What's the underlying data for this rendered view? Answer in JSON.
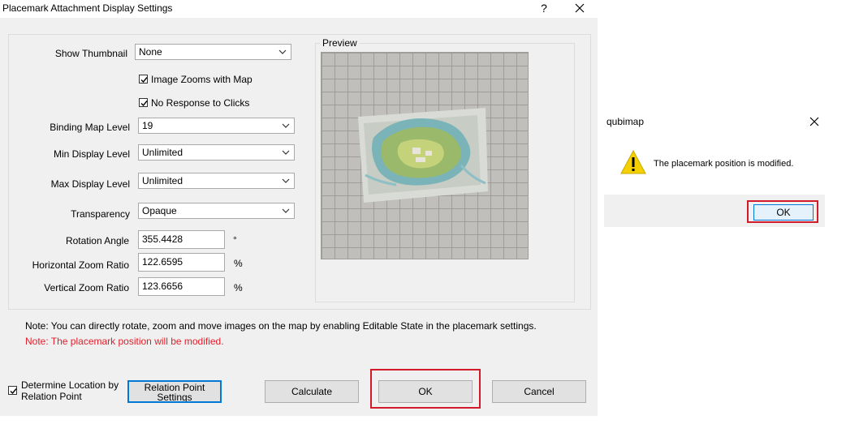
{
  "dialog": {
    "title": "Placemark Attachment Display Settings",
    "help_icon": "question-mark-icon",
    "close_icon": "close-icon",
    "show_thumbnail": {
      "label": "Show Thumbnail",
      "value": "None"
    },
    "image_zooms": {
      "label": "Image Zooms with Map",
      "checked": true
    },
    "no_response": {
      "label": "No Response to Clicks",
      "checked": true
    },
    "binding_level": {
      "label": "Binding Map Level",
      "value": "19"
    },
    "min_level": {
      "label": "Min Display Level",
      "value": "Unlimited"
    },
    "max_level": {
      "label": "Max Display Level",
      "value": "Unlimited"
    },
    "transparency": {
      "label": "Transparency",
      "value": "Opaque"
    },
    "rotation": {
      "label": "Rotation Angle",
      "value": "355.4428",
      "unit": "°"
    },
    "h_zoom": {
      "label": "Horizontal Zoom Ratio",
      "value": "122.6595",
      "unit": "%"
    },
    "v_zoom": {
      "label": "Vertical Zoom Ratio",
      "value": "123.6656",
      "unit": "%"
    },
    "preview_label": "Preview",
    "note": "Note: You can directly rotate, zoom and move images on the map by enabling Editable State in the placemark settings.",
    "warning": "Note: The placemark position will be modified.",
    "determine_location": {
      "line1": "Determine Location by",
      "line2": "Relation Point",
      "checked": true
    },
    "relation_btn": {
      "line1": "Relation Point",
      "line2": "Settings"
    },
    "calculate_btn": "Calculate",
    "ok_btn": "OK",
    "cancel_btn": "Cancel"
  },
  "message_box": {
    "title": "qubimap",
    "close_icon": "close-icon",
    "icon": "warning-triangle-icon",
    "message": "The placemark position is modified.",
    "ok_btn": "OK"
  },
  "colors": {
    "highlight_red": "#d11a2a",
    "dialog_bg": "#f0f0f0",
    "warning_text": "#e0202c",
    "warning_icon": "#f5d000"
  }
}
